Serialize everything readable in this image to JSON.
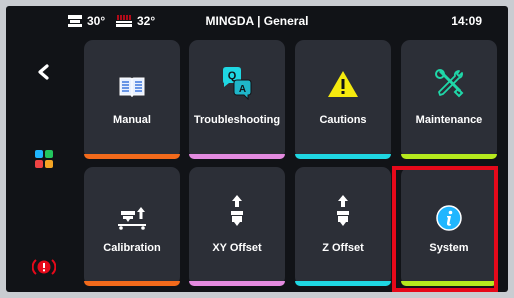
{
  "status": {
    "bed_temp": "30°",
    "nozzle_temp": "32°",
    "title": "MINGDA | General",
    "time": "14:09"
  },
  "colors": {
    "orange": "#f26a1b",
    "pink": "#e48be0",
    "cyan": "#1fd7e2",
    "lime": "#b6ea1e",
    "highlight": "#e6091a"
  },
  "tiles": [
    {
      "label": "Manual",
      "icon": "book-icon",
      "accent": "orange"
    },
    {
      "label": "Troubleshooting",
      "icon": "qa-chat-icon",
      "accent": "pink"
    },
    {
      "label": "Cautions",
      "icon": "warning-icon",
      "accent": "cyan"
    },
    {
      "label": "Maintenance",
      "icon": "tools-icon",
      "accent": "lime"
    },
    {
      "label": "Calibration",
      "icon": "calibration-icon",
      "accent": "orange"
    },
    {
      "label": "XY Offset",
      "icon": "xy-offset-icon",
      "accent": "pink"
    },
    {
      "label": "Z Offset",
      "icon": "z-offset-icon",
      "accent": "cyan"
    },
    {
      "label": "System",
      "icon": "info-icon",
      "accent": "lime"
    }
  ],
  "sidebar": {
    "back_icon": "back-chevron-icon",
    "apps_icon": "apps-grid-icon",
    "stop_icon": "emergency-stop-icon"
  }
}
